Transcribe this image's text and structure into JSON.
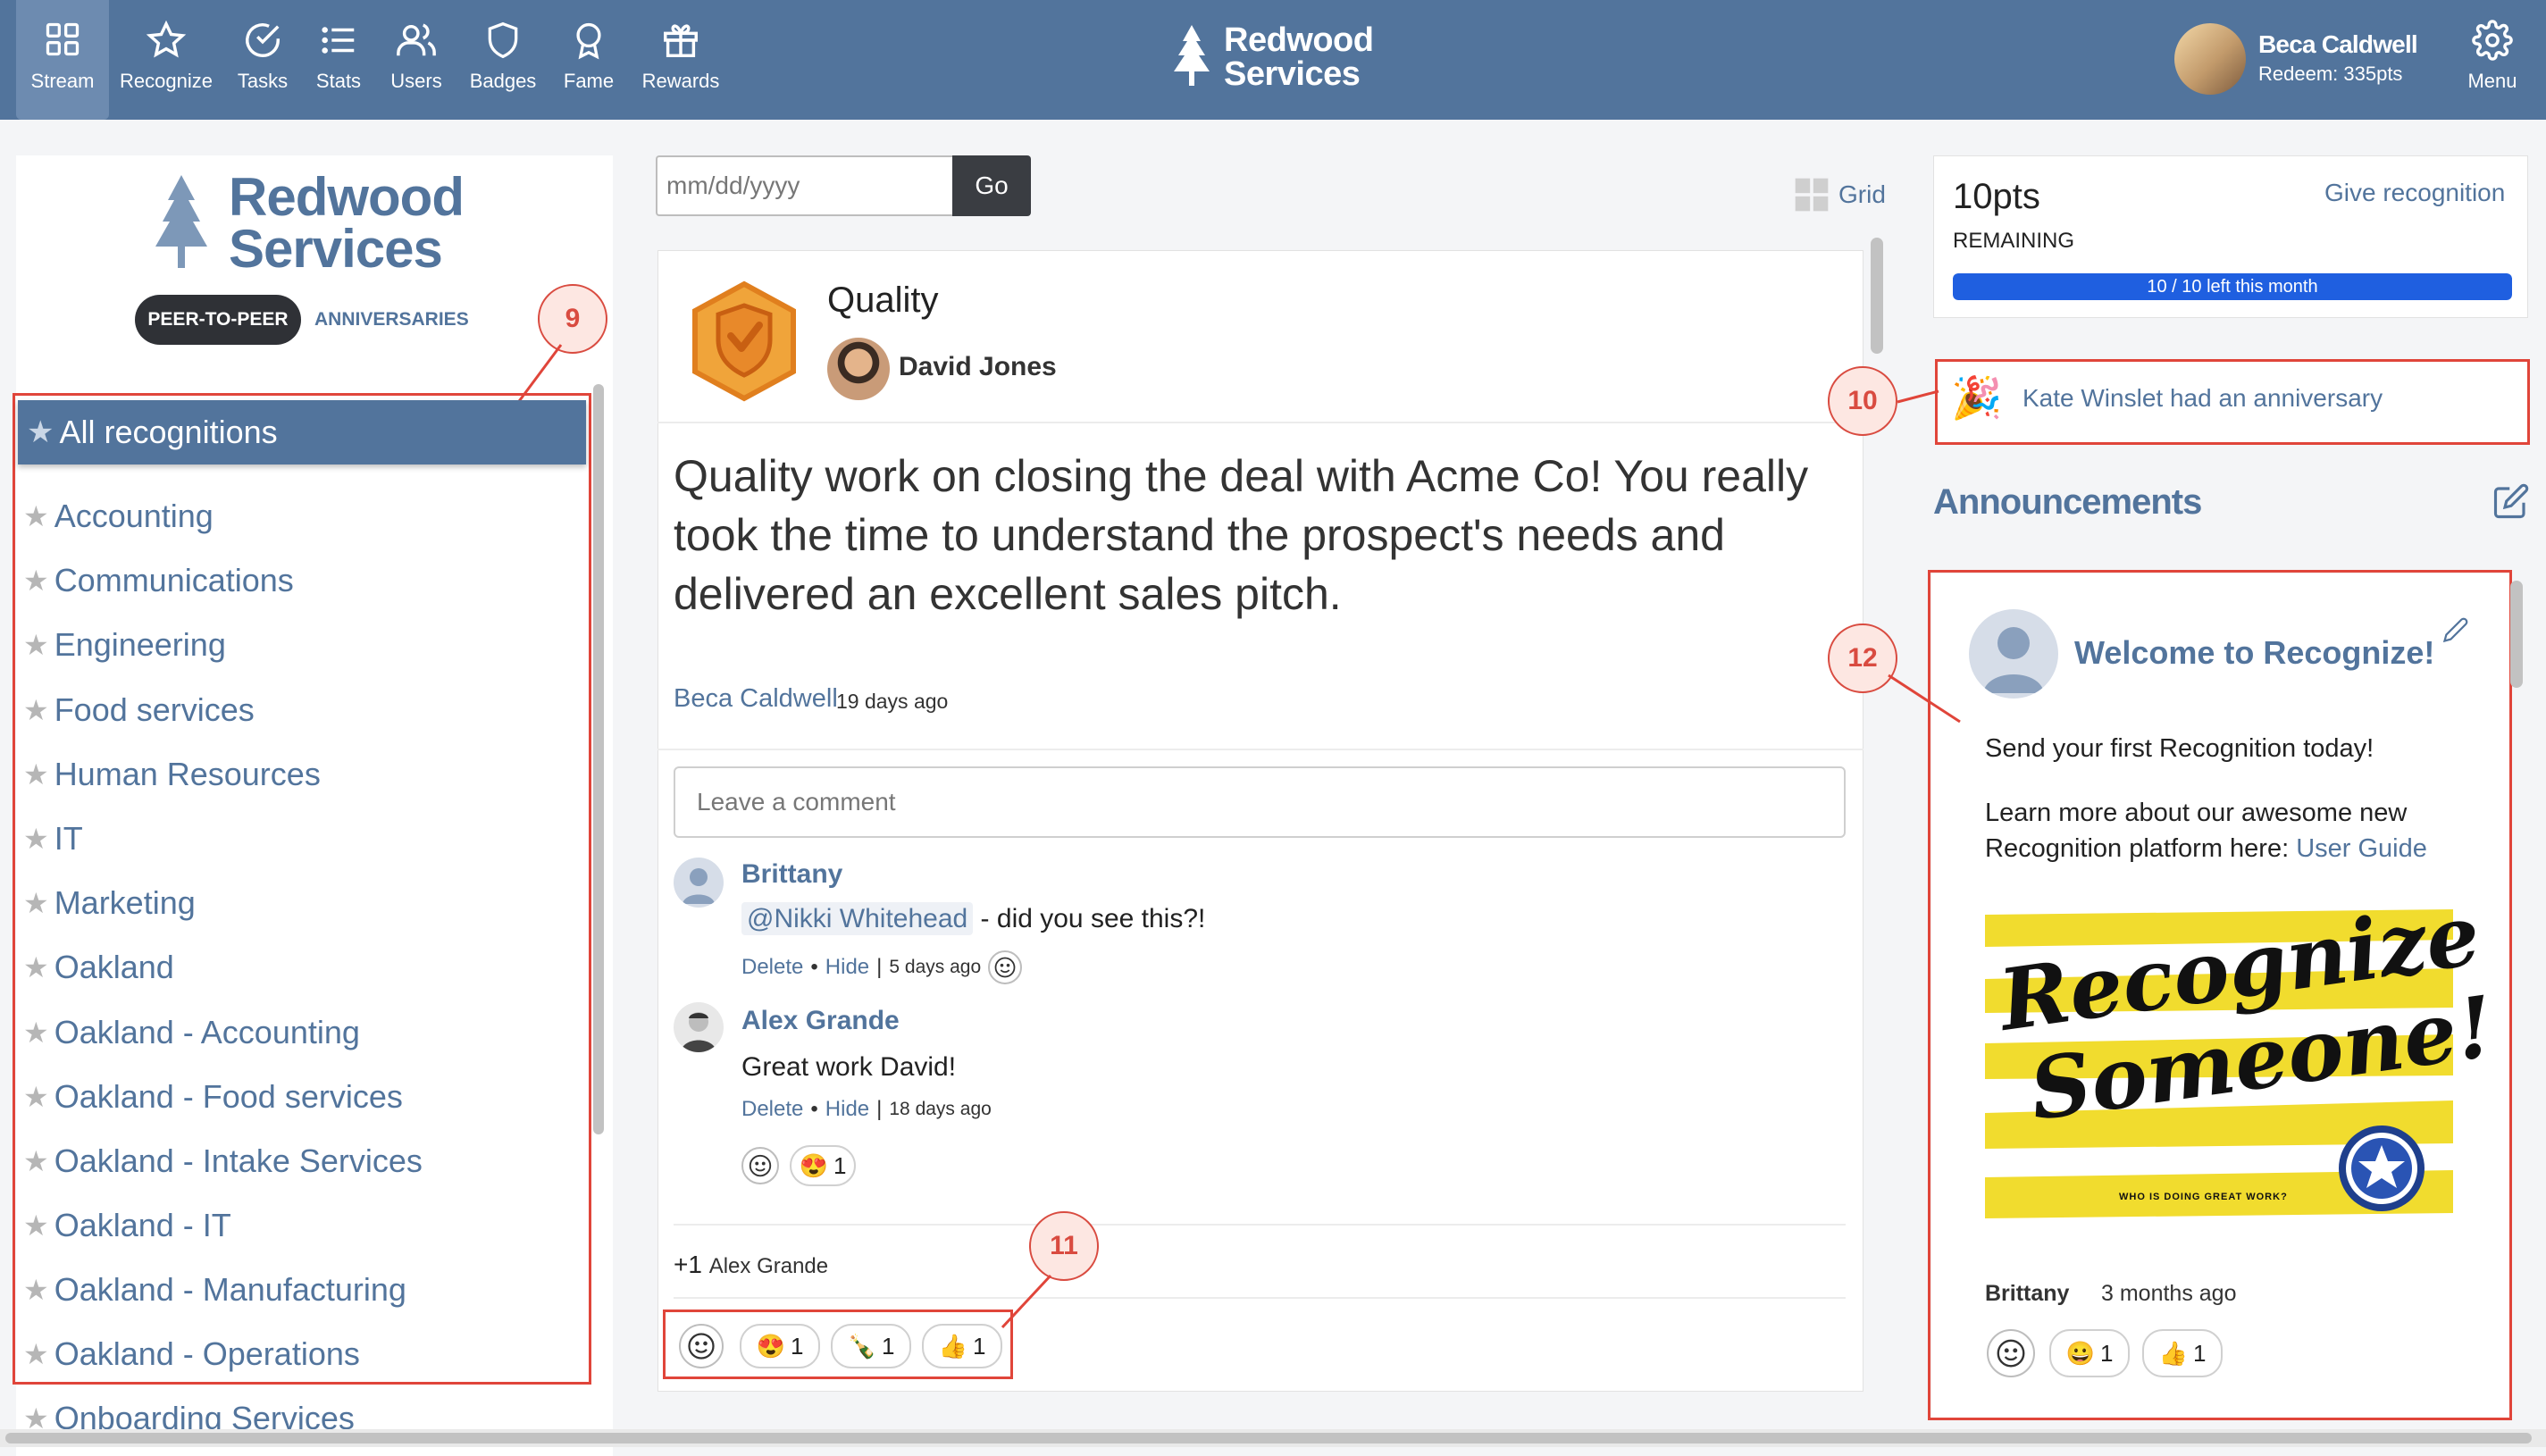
{
  "nav": {
    "items": [
      {
        "label": "Stream",
        "icon": "grid-icon"
      },
      {
        "label": "Recognize",
        "icon": "star-icon"
      },
      {
        "label": "Tasks",
        "icon": "check-circle-icon"
      },
      {
        "label": "Stats",
        "icon": "list-icon"
      },
      {
        "label": "Users",
        "icon": "users-icon"
      },
      {
        "label": "Badges",
        "icon": "shield-icon"
      },
      {
        "label": "Fame",
        "icon": "award-icon"
      },
      {
        "label": "Rewards",
        "icon": "gift-icon"
      }
    ],
    "brand_line1": "Redwood",
    "brand_line2": "Services",
    "user_name": "Beca Caldwell",
    "user_redeem": "Redeem: 335pts",
    "menu_label": "Menu"
  },
  "left": {
    "logo_line1": "Redwood",
    "logo_line2": "Services",
    "tab_p2p": "PEER-TO-PEER",
    "tab_anniversaries": "ANNIVERSARIES",
    "active_category": "All recognitions",
    "categories": [
      "Accounting",
      "Communications",
      "Engineering",
      "Food services",
      "Human Resources",
      "IT",
      "Marketing",
      "Oakland",
      "Oakland - Accounting",
      "Oakland - Food services",
      "Oakland - Intake Services",
      "Oakland - IT",
      "Oakland - Manufacturing",
      "Oakland - Operations",
      "Onboarding Services"
    ]
  },
  "annotations": {
    "a9": "9",
    "a10": "10",
    "a11": "11",
    "a12": "12"
  },
  "center": {
    "date_placeholder": "mm/dd/yyyy",
    "go_label": "Go",
    "grid_label": "Grid",
    "badge_title": "Quality",
    "giver_name": "David Jones",
    "message": "Quality work on closing the deal with Acme Co! You really took the time to understand the prospect's needs and delivered an excellent sales pitch.",
    "author": "Beca Caldwell",
    "author_ago": "19 days ago",
    "comment_placeholder": "Leave a comment",
    "comments": [
      {
        "name": "Brittany",
        "mention": "@Nikki Whitehead",
        "text": " - did you see this?!",
        "delete": "Delete",
        "hide": "Hide",
        "ago": "5 days ago"
      },
      {
        "name": "Alex Grande",
        "text": "Great work David!",
        "delete": "Delete",
        "hide": "Hide",
        "ago": "18 days ago",
        "reaction_count": "1"
      }
    ],
    "plus_one": "+1",
    "plus_one_name": "Alex Grande",
    "reactions": [
      {
        "emoji": "😍",
        "count": "1"
      },
      {
        "emoji": "🍾",
        "count": "1"
      },
      {
        "emoji": "👍",
        "count": "1"
      }
    ]
  },
  "right": {
    "points": "10pts",
    "remaining": "REMAINING",
    "give_recognition": "Give recognition",
    "progress_text": "10 / 10 left this month",
    "progress_fraction": 1.0,
    "anniversary": "Kate Winslet had an anniversary",
    "announcements_title": "Announcements",
    "ann_heading": "Welcome to Recognize!",
    "ann_line1": "Send your first Recognition today!",
    "ann_line2": "Learn more about our awesome new Recognition platform here: ",
    "ann_link": "User Guide",
    "promo_line1": "Recognize",
    "promo_line2": "Someone!",
    "promo_sub": "WHO IS DOING GREAT WORK?",
    "ann_by": "Brittany",
    "ann_ago": "3 months ago",
    "ann_reactions": [
      {
        "emoji": "😀",
        "count": "1"
      },
      {
        "emoji": "👍",
        "count": "1"
      }
    ]
  },
  "colors": {
    "nav_bg": "#52749c",
    "accent": "#52749c",
    "annotation_red": "#e0453a",
    "progress": "#1f5fe0"
  }
}
